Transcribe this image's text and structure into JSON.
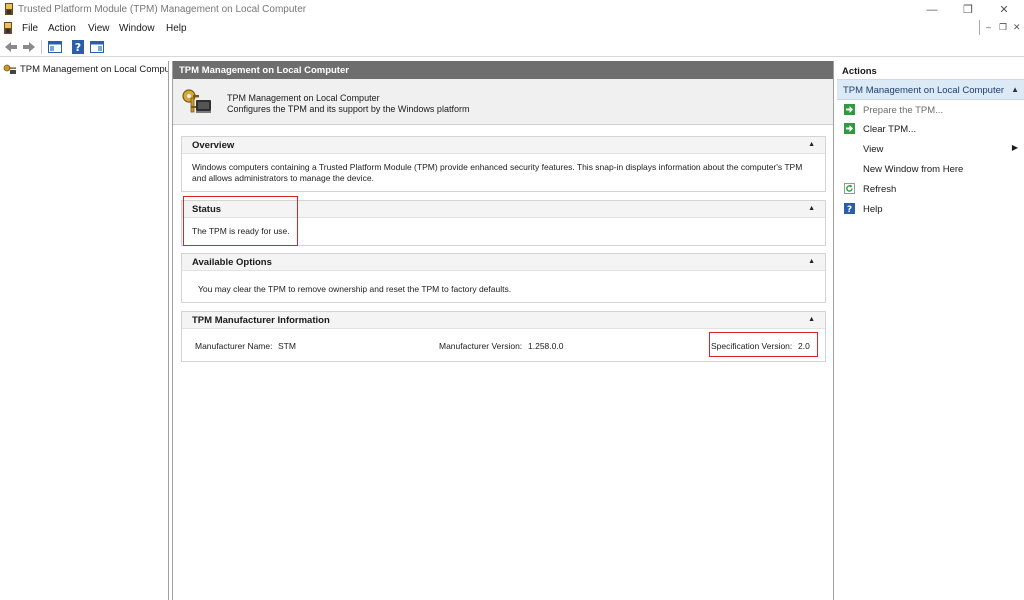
{
  "window": {
    "title": "Trusted Platform Module (TPM) Management on Local Computer",
    "minimize_glyph": "—",
    "restore_glyph": "❐",
    "close_glyph": "✕"
  },
  "menubar": {
    "items": [
      "File",
      "Action",
      "View",
      "Window",
      "Help"
    ],
    "mdi_minimize": "–",
    "mdi_restore": "❐",
    "mdi_close": "✕"
  },
  "tree": {
    "root_label": "TPM Management on Local Compu"
  },
  "center": {
    "header": "TPM Management on Local Computer",
    "intro_title": "TPM Management on Local Computer",
    "intro_subtitle": "Configures the TPM and its support by the Windows platform",
    "overview": {
      "title": "Overview",
      "text_line1": "Windows computers containing a Trusted Platform Module (TPM) provide enhanced security features. This snap-in displays information about the computer's TPM",
      "text_line2": "and allows administrators to manage the device."
    },
    "status": {
      "title": "Status",
      "text": "The TPM is ready for use."
    },
    "available_options": {
      "title": "Available Options",
      "text": "You may clear the TPM to remove ownership and reset the TPM to factory defaults."
    },
    "manufacturer": {
      "title": "TPM Manufacturer Information",
      "name_label": "Manufacturer Name:",
      "name_value": "STM",
      "version_label": "Manufacturer Version:",
      "version_value": "1.258.0.0",
      "spec_label": "Specification Version:",
      "spec_value": "2.0"
    },
    "caret": "▲"
  },
  "actions": {
    "header": "Actions",
    "section_title": "TPM Management on Local Computer",
    "section_caret": "▲",
    "items": [
      {
        "label": "Prepare the TPM...",
        "icon": "green-arrow-icon",
        "enabled": false
      },
      {
        "label": "Clear TPM...",
        "icon": "green-arrow-icon",
        "enabled": true
      },
      {
        "label": "View",
        "icon": "none",
        "enabled": true,
        "submenu": true
      },
      {
        "label": "New Window from Here",
        "icon": "none",
        "enabled": true
      },
      {
        "label": "Refresh",
        "icon": "refresh-icon",
        "enabled": true
      },
      {
        "label": "Help",
        "icon": "help-icon",
        "enabled": true
      }
    ],
    "submenu_arrow": "▶"
  },
  "colors": {
    "accent_header": "#6e6e6e",
    "actions_section_bg": "#dce9f6",
    "highlight_red": "#d9252a",
    "disabled_text": "#6d6d6d"
  }
}
